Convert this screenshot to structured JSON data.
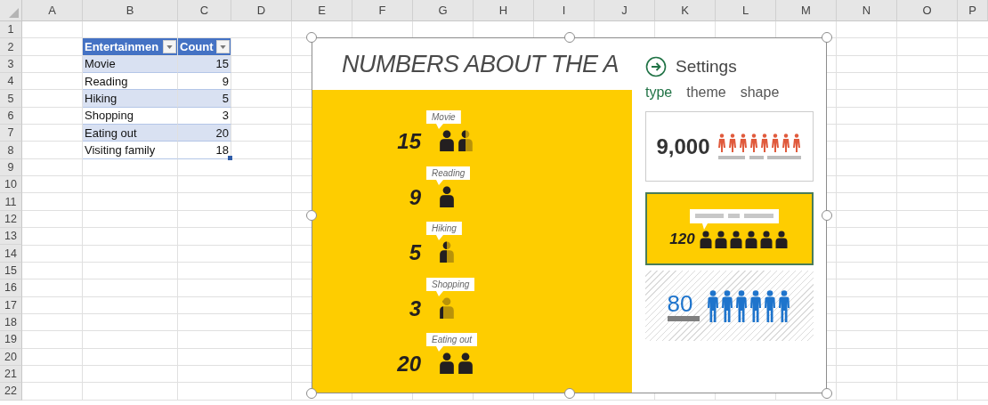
{
  "sheet": {
    "columns": [
      "A",
      "B",
      "C",
      "D",
      "E",
      "F",
      "G",
      "H",
      "I",
      "J",
      "K",
      "L",
      "M",
      "N",
      "O",
      "P"
    ],
    "rows": [
      "1",
      "2",
      "3",
      "4",
      "5",
      "6",
      "7",
      "8",
      "9",
      "10",
      "11",
      "12",
      "13",
      "14",
      "15",
      "16",
      "17",
      "18",
      "19",
      "20",
      "21",
      "22"
    ]
  },
  "table": {
    "columns": [
      "Entertainmen",
      "Count"
    ],
    "rows": [
      [
        "Movie",
        "15"
      ],
      [
        "Reading",
        "9"
      ],
      [
        "Hiking",
        "5"
      ],
      [
        "Shopping",
        "3"
      ],
      [
        "Eating out",
        "20"
      ],
      [
        "Visiting family",
        "18"
      ]
    ]
  },
  "infographic": {
    "title": "NUMBERS ABOUT THE A",
    "items": [
      {
        "label": "Movie",
        "value": "15"
      },
      {
        "label": "Reading",
        "value": "9"
      },
      {
        "label": "Hiking",
        "value": "5"
      },
      {
        "label": "Shopping",
        "value": "3"
      },
      {
        "label": "Eating out",
        "value": "20"
      }
    ]
  },
  "settings": {
    "title": "Settings",
    "tabs": [
      {
        "label": "type",
        "selected": true
      },
      {
        "label": "theme",
        "selected": false
      },
      {
        "label": "shape",
        "selected": false
      }
    ],
    "options": [
      {
        "kind": "light",
        "value": "9,000",
        "selected": false
      },
      {
        "kind": "yellow",
        "value": "120",
        "selected": true
      },
      {
        "kind": "hatched",
        "value": "80",
        "selected": false
      }
    ]
  }
}
